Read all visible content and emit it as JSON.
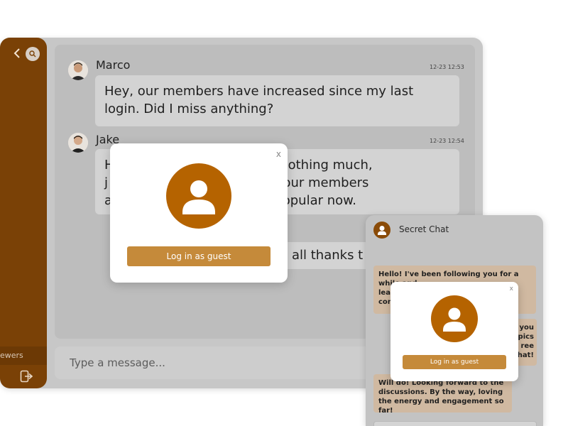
{
  "sidebar": {
    "back_icon": "chevron-left-icon",
    "search_icon": "search-icon",
    "viewers_label": "ewers",
    "logout_icon": "logout-icon"
  },
  "messages": [
    {
      "name": "Marco",
      "time": "12-23 12:53",
      "text": "Hey, our members have increased since my last login. Did I miss anything?"
    },
    {
      "name": "Jake",
      "time": "12-23 12:54",
      "text_line1": "H                               back. Nothing much,",
      "text_line2": "j                              d about our members",
      "text_line3": "a                              ind of popular now."
    },
    {
      "text": "all thanks t"
    }
  ],
  "composer": {
    "placeholder": "Type a message..."
  },
  "modal": {
    "close_label": "x",
    "button_label": "Log in as guest"
  },
  "widget": {
    "title": "Secret Chat",
    "bubbles": [
      "Hello! I've been following you for a while and",
      "lea",
      "con",
      "you",
      "pics",
      "ree",
      "hat!",
      "Will do! Looking forward to the discussions. By the way, loving the energy and engagement so far!"
    ]
  },
  "widget_modal": {
    "close_label": "x",
    "button_label": "Log in as guest"
  },
  "colors": {
    "sidebar": "#7a4106",
    "accent": "#b56300",
    "button": "#c58a3a"
  }
}
